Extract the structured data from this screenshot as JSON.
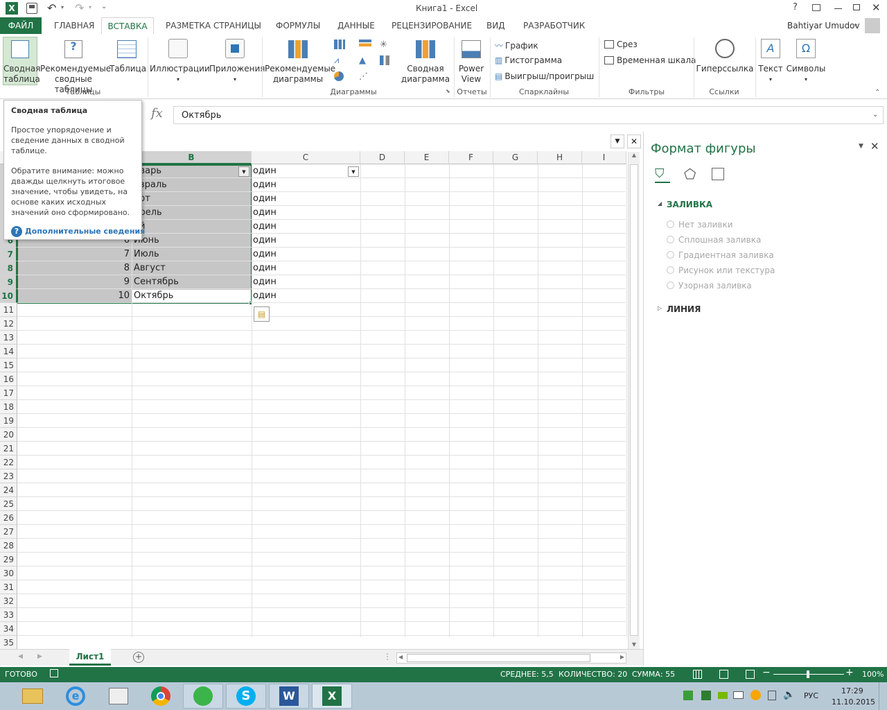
{
  "window": {
    "title": "Книга1 - Excel",
    "help": "?"
  },
  "tabs": [
    "ФАЙЛ",
    "ГЛАВНАЯ",
    "ВСТАВКА",
    "РАЗМЕТКА СТРАНИЦЫ",
    "ФОРМУЛЫ",
    "ДАННЫЕ",
    "РЕЦЕНЗИРОВАНИЕ",
    "ВИД",
    "РАЗРАБОТЧИК"
  ],
  "user": "Bahtiyar Umudov",
  "ribbon": {
    "pivot_table": "Сводная\nтаблица",
    "recommended_pivot": "Рекомендуемые\nсводные таблицы",
    "table": "Таблица",
    "illustrations": "Иллюстрации",
    "apps": "Приложения",
    "recommended_charts": "Рекомендуемые\nдиаграммы",
    "pivot_chart": "Сводная\nдиаграмма",
    "power_view": "Power\nView",
    "line": "График",
    "histogram": "Гистограмма",
    "winloss": "Выигрыш/проигрыш",
    "slicer": "Срез",
    "timeline": "Временная шкала",
    "hyperlink": "Гиперссылка",
    "text": "Текст",
    "symbols": "Символы",
    "groups": {
      "tables": "Таблицы",
      "charts": "Диаграммы",
      "reports": "Отчеты",
      "sparklines": "Спарклайны",
      "filters": "Фильтры",
      "links": "Ссылки"
    }
  },
  "formula": {
    "fx": "fx",
    "value": "Октябрь"
  },
  "columns": [
    "B",
    "C",
    "D",
    "E",
    "F",
    "G",
    "H",
    "I"
  ],
  "rows": {
    "numbers": [
      "6",
      "7",
      "8",
      "9",
      "10",
      "11",
      "12",
      "13",
      "14",
      "15",
      "16",
      "17",
      "18",
      "19",
      "20",
      "21",
      "22",
      "23",
      "24",
      "25",
      "26",
      "27",
      "28",
      "29",
      "30",
      "31",
      "32",
      "33",
      "34",
      "35"
    ],
    "a_values": [
      "6",
      "7",
      "8",
      "9",
      "10"
    ],
    "b_values": [
      "нварь",
      "евраль",
      "арт",
      "прель",
      "ай",
      "Июнь",
      "Июль",
      "Август",
      "Сентябрь",
      "Октябрь"
    ],
    "c_values": [
      "один",
      "один",
      "один",
      "один",
      "один",
      "один",
      "один",
      "один",
      "один",
      "один"
    ]
  },
  "tooltip": {
    "title": "Сводная таблица",
    "body1": "Простое упорядочение и сведение данных в сводной таблице.",
    "body2": "Обратите внимание: можно дважды щелкнуть итоговое значение, чтобы увидеть, на основе каких исходных значений оно сформировано.",
    "more": "Дополнительные сведения"
  },
  "taskpane": {
    "title": "Формат фигуры",
    "fill_header": "ЗАЛИВКА",
    "options": [
      "Нет заливки",
      "Сплошная заливка",
      "Градиентная заливка",
      "Рисунок или текстура",
      "Узорная заливка"
    ],
    "line_header": "ЛИНИЯ"
  },
  "sheet_tab": "Лист1",
  "status": {
    "ready": "ГОТОВО",
    "average": "СРЕДНЕЕ: 5,5",
    "count": "КОЛИЧЕСТВО: 20",
    "sum": "СУММА: 55",
    "zoom": "100%"
  },
  "taskbar": {
    "lang": "РУС",
    "time": "17:29",
    "date": "11.10.2015"
  },
  "colors": {
    "excel_green": "#217346",
    "selection": "#c6c6c6",
    "accent": "#217346"
  }
}
